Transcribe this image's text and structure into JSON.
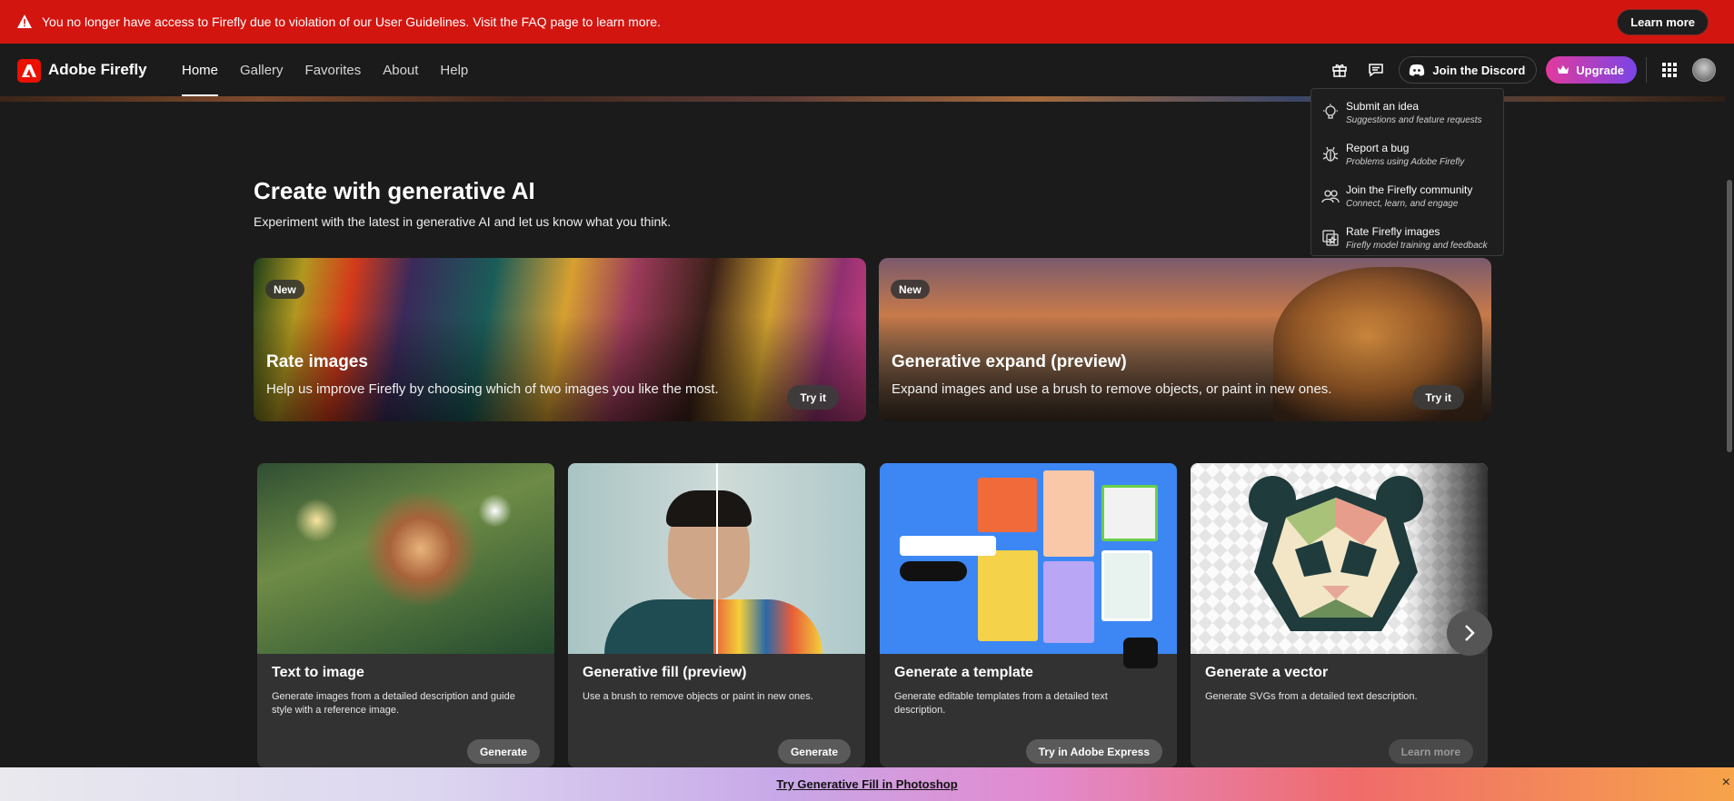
{
  "alert": {
    "message": "You no longer have access to Firefly due to violation of our User Guidelines. Visit the FAQ page to learn more.",
    "button": "Learn more",
    "color": "#d31510"
  },
  "header": {
    "brand": "Adobe Firefly",
    "tabs": [
      {
        "label": "Home",
        "active": true
      },
      {
        "label": "Gallery"
      },
      {
        "label": "Favorites"
      },
      {
        "label": "About"
      },
      {
        "label": "Help"
      }
    ],
    "discord": "Join the Discord",
    "upgrade": "Upgrade",
    "icons": [
      "gift-icon",
      "feedback-icon",
      "discord-icon",
      "crown-icon",
      "apps-grid-icon",
      "avatar"
    ]
  },
  "main": {
    "title": "Create with generative AI",
    "subtitle": "Experiment with the latest in generative AI and let us know what you think.",
    "features": [
      {
        "badge": "New",
        "title": "Rate images",
        "desc": "Help us improve Firefly by choosing which of two images you like the most.",
        "button": "Try it"
      },
      {
        "badge": "New",
        "title": "Generative expand (preview)",
        "desc": "Expand images and use a brush to remove objects, or paint in new ones.",
        "button": "Try it"
      }
    ],
    "cards": [
      {
        "title": "Text to image",
        "desc": "Generate images from a detailed description and guide style with a reference image.",
        "button": "Generate"
      },
      {
        "title": "Generative fill (preview)",
        "desc": "Use a brush to remove objects or paint in new ones.",
        "button": "Generate"
      },
      {
        "title": "Generate a template",
        "desc": "Generate editable templates from a detailed text description.",
        "button": "Try in Adobe Express"
      },
      {
        "title": "Generate a vector",
        "desc": "Generate SVGs from a detailed text description.",
        "button": "Learn more"
      }
    ]
  },
  "menu": {
    "items": [
      {
        "title": "Submit an idea",
        "sub": "Suggestions and feature requests",
        "icon": "lightbulb-icon"
      },
      {
        "title": "Report a bug",
        "sub": "Problems using Adobe Firefly",
        "icon": "bug-icon"
      },
      {
        "title": "Join the Firefly community",
        "sub": "Connect, learn, and engage",
        "icon": "community-icon"
      },
      {
        "title": "Rate Firefly images",
        "sub": "Firefly model training and feedback",
        "icon": "rate-images-icon"
      }
    ]
  },
  "bottom": {
    "link": "Try Generative Fill in Photoshop"
  }
}
